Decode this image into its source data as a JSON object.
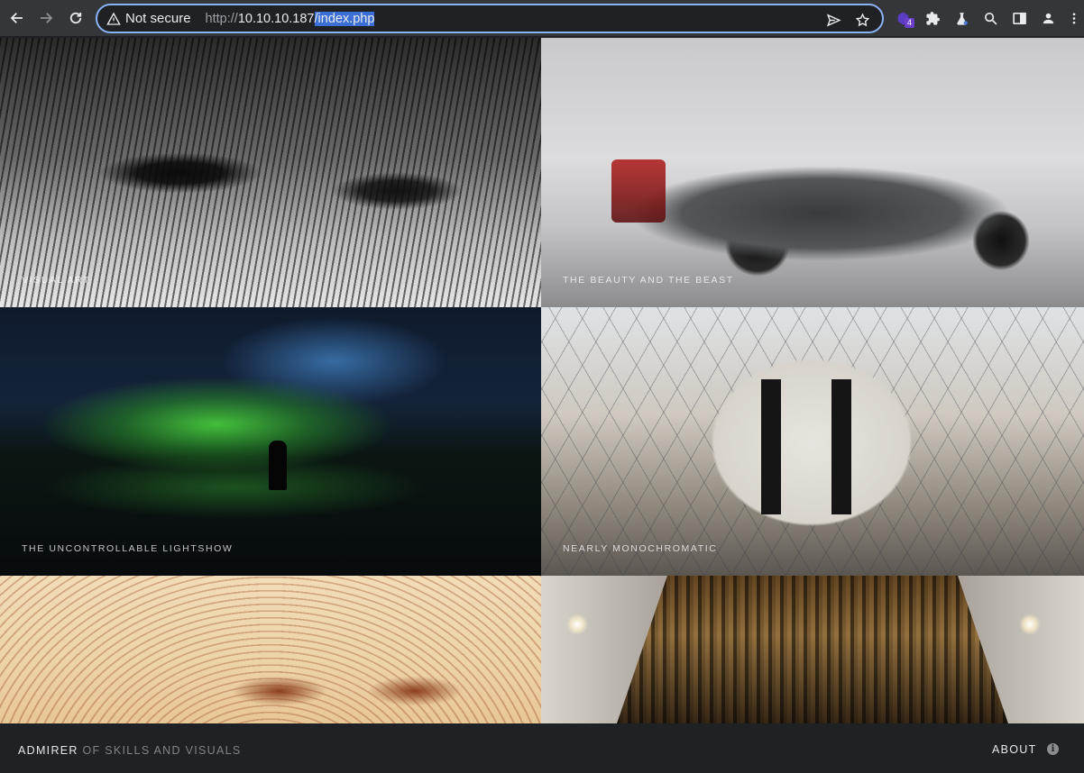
{
  "browser": {
    "security_label": "Not secure",
    "url_scheme": "http://",
    "url_host": "10.10.10.187",
    "url_path": "/index.php",
    "extension_badge": "4",
    "icons": [
      "back-arrow",
      "forward-arrow",
      "reload",
      "warning-triangle",
      "send-tab",
      "bookmark-star",
      "hexagon-extension",
      "puzzle-extensions",
      "flask-extension",
      "search",
      "side-panel",
      "profile",
      "kebab-menu"
    ]
  },
  "gallery": {
    "tiles": [
      {
        "label": "VISUAL ART"
      },
      {
        "label": "THE BEAUTY AND THE BEAST"
      },
      {
        "label": "THE UNCONTROLLABLE LIGHTSHOW"
      },
      {
        "label": "NEARLY MONOCHROMATIC"
      },
      {
        "label": ""
      },
      {
        "label": ""
      }
    ]
  },
  "footer": {
    "brand_strong": "ADMIRER",
    "brand_soft": "OF SKILLS AND VISUALS",
    "about_label": "ABOUT",
    "info_glyph": "i"
  },
  "colors": {
    "toolbar_bg": "#35363a",
    "omnibox_border": "#8ab4f8",
    "url_highlight": "#3b6fd6",
    "footer_bg": "#1f2224"
  }
}
